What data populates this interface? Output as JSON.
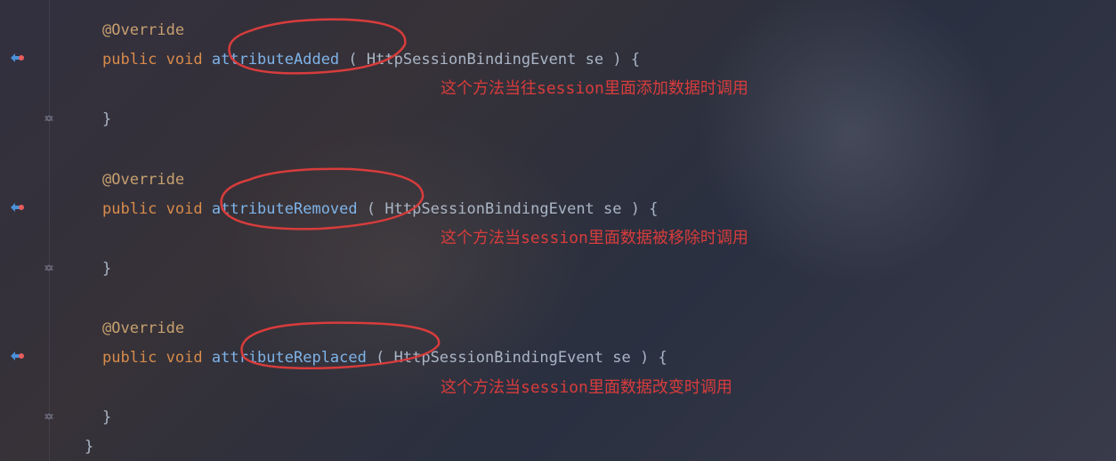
{
  "code": {
    "method1": {
      "annotation": "@Override",
      "modifier": "public",
      "returnType": "void",
      "name": "attributeAdded",
      "paramType": "HttpSessionBindingEvent",
      "paramName": "se",
      "openBrace": "{",
      "closeBrace": "}",
      "comment": "这个方法当往session里面添加数据时调用"
    },
    "method2": {
      "annotation": "@Override",
      "modifier": "public",
      "returnType": "void",
      "name": "attributeRemoved",
      "paramType": "HttpSessionBindingEvent",
      "paramName": "se",
      "openBrace": "{",
      "closeBrace": "}",
      "comment": "这个方法当session里面数据被移除时调用"
    },
    "method3": {
      "annotation": "@Override",
      "modifier": "public",
      "returnType": "void",
      "name": "attributeReplaced",
      "paramType": "HttpSessionBindingEvent",
      "paramName": "se",
      "openBrace": "{",
      "closeBrace": "}",
      "comment": "这个方法当session里面数据改变时调用"
    },
    "classClose": "}"
  },
  "icons": {
    "override": "override-icon",
    "expand": "expand-icon"
  }
}
